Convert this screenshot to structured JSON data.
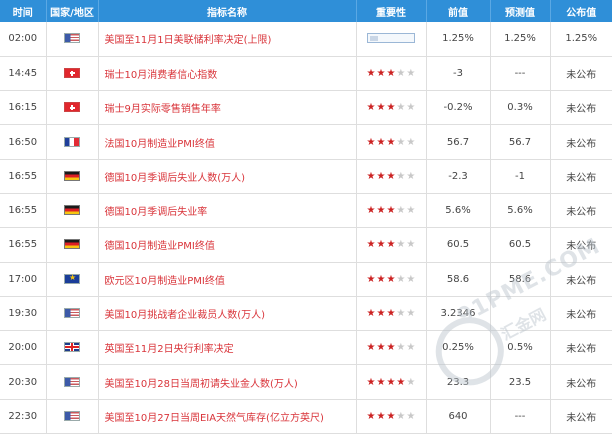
{
  "header": {
    "time": "时间",
    "country": "国家/地区",
    "indicator": "指标名称",
    "importance": "重要性",
    "previous": "前值",
    "forecast": "预测值",
    "actual": "公布值"
  },
  "rows": [
    {
      "time": "02:00",
      "flag": "us",
      "name": "美国至11月1日美联储利率决定(上限)",
      "stars": null,
      "previous": "1.25%",
      "forecast": "1.25%",
      "actual": "1.25%"
    },
    {
      "time": "14:45",
      "flag": "ch",
      "name": "瑞士10月消费者信心指数",
      "stars": 3,
      "previous": "-3",
      "forecast": "---",
      "actual": "未公布"
    },
    {
      "time": "16:15",
      "flag": "ch",
      "name": "瑞士9月实际零售销售年率",
      "stars": 3,
      "previous": "-0.2%",
      "forecast": "0.3%",
      "actual": "未公布"
    },
    {
      "time": "16:50",
      "flag": "fr",
      "name": "法国10月制造业PMI终值",
      "stars": 3,
      "previous": "56.7",
      "forecast": "56.7",
      "actual": "未公布"
    },
    {
      "time": "16:55",
      "flag": "de",
      "name": "德国10月季调后失业人数(万人)",
      "stars": 3,
      "previous": "-2.3",
      "forecast": "-1",
      "actual": "未公布"
    },
    {
      "time": "16:55",
      "flag": "de",
      "name": "德国10月季调后失业率",
      "stars": 3,
      "previous": "5.6%",
      "forecast": "5.6%",
      "actual": "未公布"
    },
    {
      "time": "16:55",
      "flag": "de",
      "name": "德国10月制造业PMI终值",
      "stars": 3,
      "previous": "60.5",
      "forecast": "60.5",
      "actual": "未公布"
    },
    {
      "time": "17:00",
      "flag": "eu",
      "name": "欧元区10月制造业PMI终值",
      "stars": 3,
      "previous": "58.6",
      "forecast": "58.6",
      "actual": "未公布"
    },
    {
      "time": "19:30",
      "flag": "us",
      "name": "美国10月挑战者企业裁员人数(万人)",
      "stars": 3,
      "previous": "3.2346",
      "forecast": "",
      "actual": "未公布"
    },
    {
      "time": "20:00",
      "flag": "gb",
      "name": "英国至11月2日央行利率决定",
      "stars": 3,
      "previous": "0.25%",
      "forecast": "0.5%",
      "actual": "未公布"
    },
    {
      "time": "20:30",
      "flag": "us",
      "name": "美国至10月28日当周初请失业金人数(万人)",
      "stars": 4,
      "previous": "23.3",
      "forecast": "23.5",
      "actual": "未公布"
    },
    {
      "time": "22:30",
      "flag": "us",
      "name": "美国至10月27日当周EIA天然气库存(亿立方英尺)",
      "stars": 3,
      "previous": "640",
      "forecast": "---",
      "actual": "未公布"
    }
  ],
  "watermark": {
    "main": "91PME.COM",
    "sub": "汇金网"
  },
  "colors": {
    "header_bg": "#2f8fd8",
    "indicator_text": "#d9343a",
    "star_on": "#cc2222",
    "star_off": "#c8c8c8"
  }
}
